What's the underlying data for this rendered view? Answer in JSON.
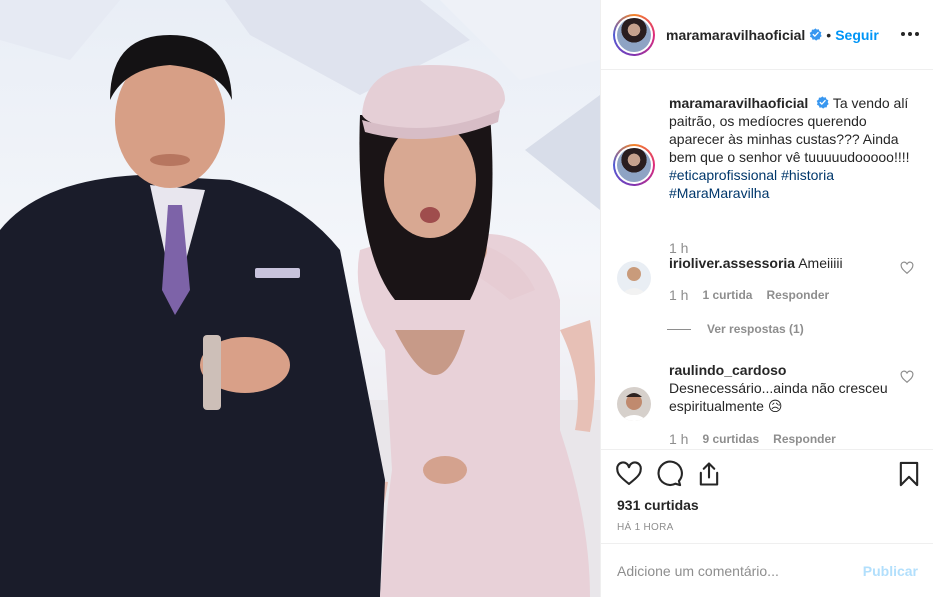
{
  "post": {
    "image_alt": "",
    "author": {
      "username": "maramaravilhaoficial",
      "verified": true,
      "follow_label": "Seguir",
      "separator": "•"
    },
    "caption": {
      "username": "maramaravilhaoficial",
      "text": "Ta vendo alí paitrão, os medíocres querendo aparecer às minhas custas??? Ainda bem que o senhor vê tuuuuudooooo!!!!",
      "hashtags": [
        "#eticaprofissional",
        "#historia",
        "#MaraMaravilha"
      ],
      "time": "1 h"
    },
    "comments": [
      {
        "username": "irioliver.assessoria",
        "text": "Ameiiiii",
        "time": "1 h",
        "likes": "1 curtida",
        "reply_label": "Responder",
        "view_replies": "Ver respostas (1)"
      },
      {
        "username": "raulindo_cardoso",
        "text": "Desnecessário...ainda não cresceu espiritualmente",
        "emoji": "😥",
        "time": "1 h",
        "likes": "9 curtidas",
        "reply_label": "Responder"
      }
    ],
    "likes_count": "931 curtidas",
    "posted_ago": "HÁ 1 HORA",
    "comment_box": {
      "placeholder": "Adicione um comentário...",
      "publish_label": "Publicar"
    },
    "icons": {
      "verified": "verified-badge-icon",
      "more": "more-options-icon",
      "like": "heart-icon",
      "comment": "comment-bubble-icon",
      "share": "share-icon",
      "save": "bookmark-icon"
    },
    "colors": {
      "accent": "#0095f6",
      "publish_disabled": "#b2dffc",
      "hashtag": "#00376b",
      "muted": "#8e8e8e"
    }
  }
}
